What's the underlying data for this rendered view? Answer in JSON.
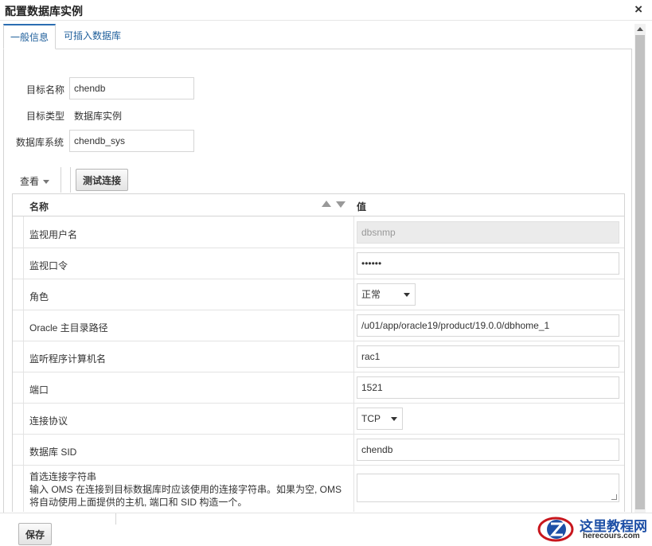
{
  "dialog": {
    "title": "配置数据库实例",
    "close_icon": "×"
  },
  "tabs": [
    {
      "label": "一般信息",
      "active": true
    },
    {
      "label": "可插入数据库",
      "active": false
    }
  ],
  "general": {
    "target_name_label": "目标名称",
    "target_name_value": "chendb",
    "target_type_label": "目标类型",
    "target_type_value": "数据库实例",
    "db_system_label": "数据库系统",
    "db_system_value": "chendb_sys"
  },
  "toolbar": {
    "view_label": "查看",
    "test_connection_label": "测试连接"
  },
  "table": {
    "col_name": "名称",
    "col_value": "值",
    "rows": [
      {
        "name": "监视用户名",
        "value": "dbsnmp",
        "kind": "readonly"
      },
      {
        "name": "监视口令",
        "value": "••••••",
        "kind": "password"
      },
      {
        "name": "角色",
        "value": "正常",
        "kind": "select"
      },
      {
        "name": "Oracle 主目录路径",
        "value": "/u01/app/oracle19/product/19.0.0/dbhome_1",
        "kind": "text"
      },
      {
        "name": "监听程序计算机名",
        "value": "rac1",
        "kind": "text"
      },
      {
        "name": "端口",
        "value": "1521",
        "kind": "text"
      },
      {
        "name": "连接协议",
        "value": "TCP",
        "kind": "select"
      },
      {
        "name": "数据库 SID",
        "value": "chendb",
        "kind": "text"
      }
    ],
    "last_row": {
      "name": "首选连接字符串",
      "desc_line1": "输入 OMS 在连接到目标数据库时应该使用的连接字符串。如果为空, OMS",
      "desc_line2": "将自动使用上面提供的主机, 端口和 SID 构造一个。",
      "value": ""
    }
  },
  "footer": {
    "save_label": "保存"
  },
  "watermark": {
    "title": "这里教程网",
    "url": "herecours.com"
  },
  "colors": {
    "accent": "#2a6db2",
    "tab_text": "#1f5f9b",
    "border": "#d4d4d4"
  }
}
